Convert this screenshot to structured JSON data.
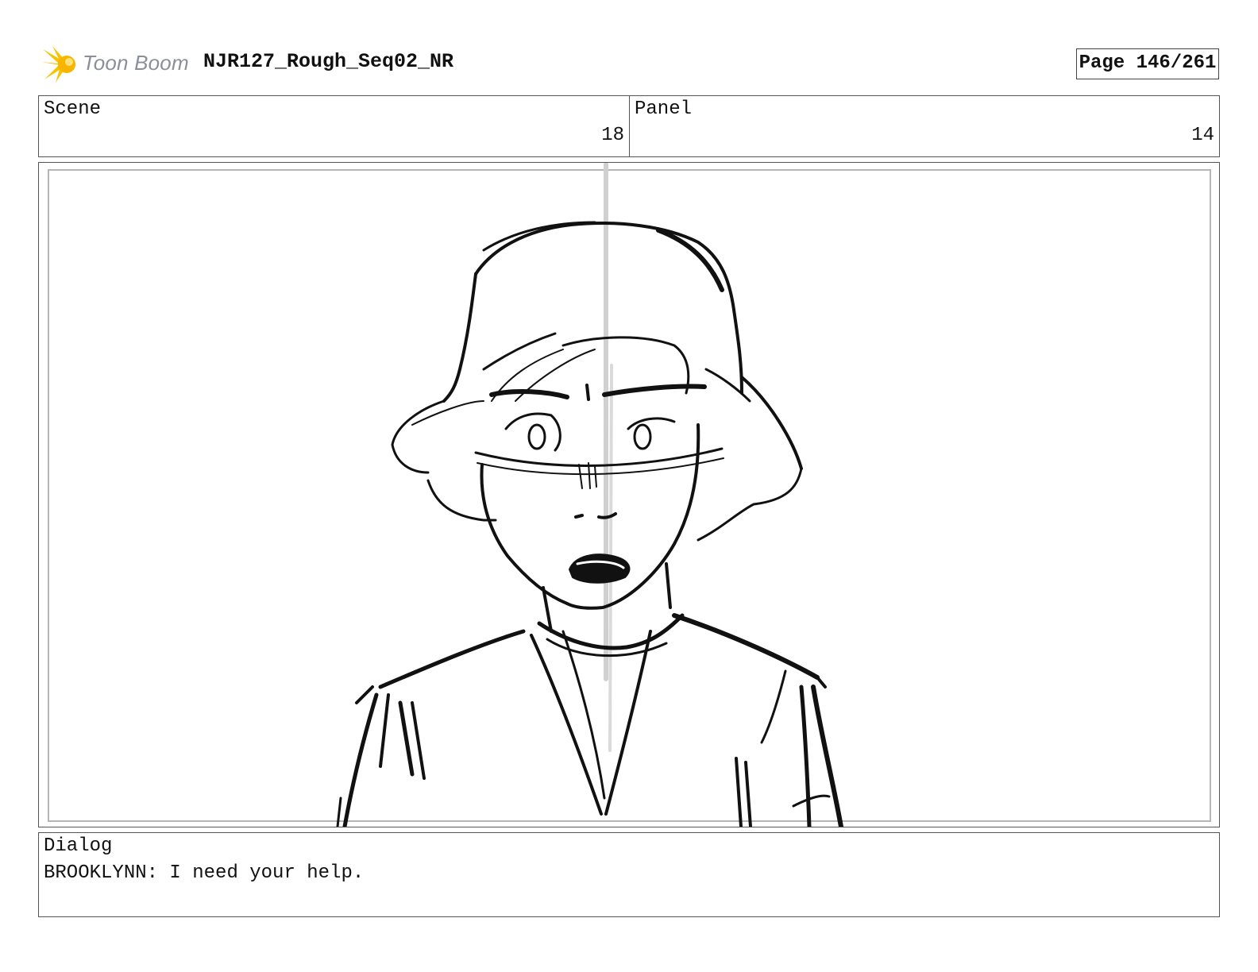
{
  "header": {
    "logo_text": "Toon Boom",
    "project_title": "NJR127_Rough_Seq02_NR",
    "page_label": "Page 146/261"
  },
  "info": {
    "scene_label": "Scene",
    "scene_number": "18",
    "panel_label": "Panel",
    "panel_number": "14"
  },
  "frame": {
    "image_subject": "storyboard-sketch"
  },
  "dialog": {
    "label": "Dialog",
    "text": "BROOKLYNN: I need your help."
  },
  "colors": {
    "logo_star": "#f5c400",
    "logo_text": "#8a8f99",
    "ink": "#111111",
    "frame_border": "#b5b5b5"
  }
}
